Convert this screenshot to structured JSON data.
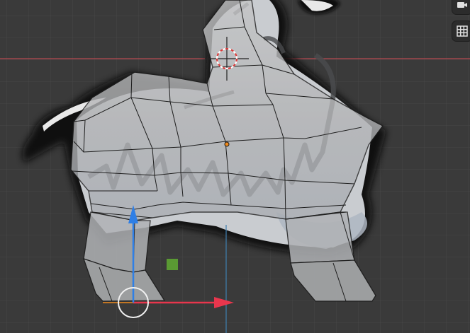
{
  "viewport": {
    "background": "#3a3a3a",
    "grid_color": "#474747",
    "x_axis_color": "#b64a52",
    "y_axis_color": "#3f7fb0"
  },
  "model": {
    "mesh_fill": "#b7b8b9",
    "edge_color": "#1e1e1e",
    "reference_image": "sheep-sketch-reference"
  },
  "cursor": {
    "icon": "3d-cursor-icon",
    "color": "#d93b3b"
  },
  "origin": {
    "color": "#f08a1c"
  },
  "gizmo": {
    "x_color": "#e8364d",
    "y_color": "#2f7fe6",
    "center_color": "#f2f2f2",
    "handle_color": "#5a9a33"
  },
  "side_buttons": [
    {
      "name": "camera-view-button",
      "icon": "camera-icon"
    },
    {
      "name": "toggle-grid-button",
      "icon": "grid-icon"
    }
  ]
}
